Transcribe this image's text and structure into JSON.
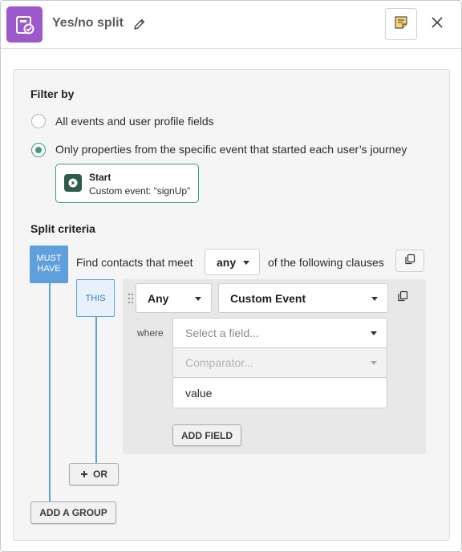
{
  "header": {
    "title": "Yes/no split",
    "icons": {
      "node": "split-node-icon",
      "edit": "pencil-icon",
      "notes": "notes-icon",
      "close": "close-icon"
    }
  },
  "filter": {
    "title": "Filter by",
    "options": [
      {
        "label": "All events and user profile fields",
        "checked": false
      },
      {
        "label": "Only properties from the specific event that started each user’s journey",
        "checked": true
      }
    ],
    "start_card": {
      "title": "Start",
      "subtitle": "Custom event: “signUp”"
    }
  },
  "split": {
    "title": "Split criteria",
    "group_label": "MUST HAVE",
    "find_prefix": "Find contacts that meet",
    "match_value": "any",
    "find_suffix": "of the following clauses",
    "clause": {
      "label": "THIS",
      "quantifier": "Any",
      "event_type": "Custom Event",
      "where_label": "where",
      "field_placeholder": "Select a field...",
      "comparator_placeholder": "Comparator...",
      "value": "value",
      "add_field_label": "ADD FIELD"
    },
    "or_label": "OR",
    "add_group_label": "ADD A GROUP"
  },
  "colors": {
    "accent_green": "#3d9d7c",
    "accent_blue": "#5f9fdb",
    "node_purple": "#9b59c9"
  }
}
